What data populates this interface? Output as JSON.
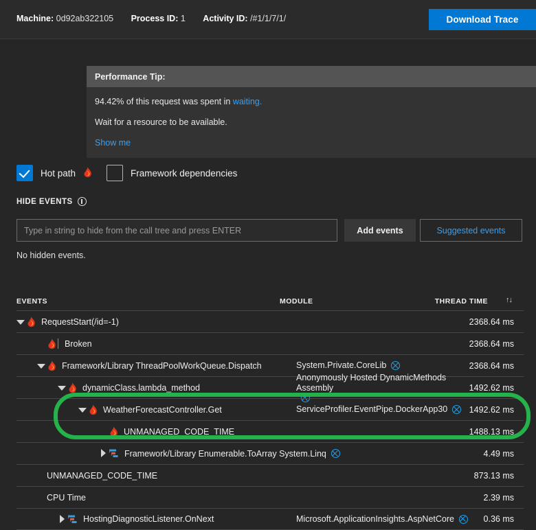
{
  "topbar": {
    "machine_label": "Machine:",
    "machine_value": "0d92ab322105",
    "process_label": "Process ID:",
    "process_value": "1",
    "activity_label": "Activity ID:",
    "activity_value": "/#1/1/7/1/",
    "download_label": "Download Trace",
    "accent": "#0078d4"
  },
  "perf_tip": {
    "header": "Performance Tip:",
    "line1_prefix": "94.42% of this request was spent in ",
    "line1_link": "waiting.",
    "line2": "Wait for a resource to be available.",
    "show_me": "Show me"
  },
  "options": {
    "hot_path_label": "Hot path",
    "hot_path_checked": true,
    "framework_label": "Framework dependencies",
    "framework_checked": false
  },
  "hide_events": {
    "title": "HIDE EVENTS",
    "info_icon": "info-icon",
    "input_value": "",
    "input_placeholder": "Type in string to hide from the call tree and press ENTER",
    "add_label": "Add events",
    "suggested_label": "Suggested events",
    "status": "No hidden events."
  },
  "table": {
    "headers": {
      "events": "EVENTS",
      "module": "MODULE",
      "thread_time": "THREAD TIME",
      "sort_icon": "sort-updown-icon"
    },
    "rows": [
      {
        "indent": 14,
        "twisty": "open",
        "icon": "flame-icon",
        "bar": false,
        "name": "RequestStart(/id=-1)",
        "module": "",
        "has_close": false,
        "time": "2368.64 ms"
      },
      {
        "indent": 44,
        "twisty": "none",
        "icon": "flame-icon",
        "bar": true,
        "name": "Broken",
        "module": "",
        "has_close": false,
        "time": "2368.64 ms"
      },
      {
        "indent": 44,
        "twisty": "open",
        "icon": "flame-icon",
        "bar": false,
        "name": "Framework/Library ThreadPoolWorkQueue.Dispatch",
        "module": "System.Private.CoreLib",
        "has_close": true,
        "time": "2368.64 ms"
      },
      {
        "indent": 74,
        "twisty": "open",
        "icon": "flame-icon",
        "bar": false,
        "name": "dynamicClass.lambda_method",
        "module": "Anonymously Hosted DynamicMethods Assembly",
        "has_close": true,
        "time": "1492.62 ms"
      },
      {
        "indent": 104,
        "twisty": "open",
        "icon": "flame-icon",
        "bar": false,
        "name": "WeatherForecastController.Get",
        "module": "ServiceProfiler.EventPipe.DockerApp30",
        "has_close": true,
        "time": "1492.62 ms"
      },
      {
        "indent": 134,
        "twisty": "none",
        "icon": "flame-icon",
        "bar": false,
        "name": "UNMANAGED_CODE_TIME",
        "module": "",
        "has_close": false,
        "time": "1488.13 ms"
      },
      {
        "indent": 134,
        "twisty": "closed",
        "icon": "gantt-icon",
        "bar": false,
        "name": "Framework/Library Enumerable.ToArray System.Linq",
        "module": "",
        "has_close": true,
        "close_inline": true,
        "time": "4.49 ms"
      },
      {
        "indent": 44,
        "twisty": "none",
        "icon": "none",
        "bar": false,
        "name": "UNMANAGED_CODE_TIME",
        "module": "",
        "has_close": false,
        "time": "873.13 ms"
      },
      {
        "indent": 44,
        "twisty": "none",
        "icon": "none",
        "bar": false,
        "name": "CPU Time",
        "module": "",
        "has_close": false,
        "time": "2.39 ms"
      },
      {
        "indent": 74,
        "twisty": "closed",
        "icon": "gantt-icon",
        "bar": false,
        "name": "HostingDiagnosticListener.OnNext",
        "module": "Microsoft.ApplicationInsights.AspNetCore",
        "has_close": true,
        "time": "0.36 ms"
      }
    ]
  },
  "annotation": {
    "shape": "rounded-rect-highlight",
    "color": "#26b24b"
  }
}
